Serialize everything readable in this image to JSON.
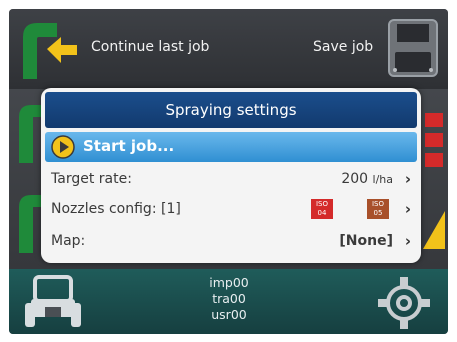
{
  "header": {
    "continue_label": "Continue last job",
    "save_label": "Save job"
  },
  "dialog": {
    "title": "Spraying settings",
    "start_label": "Start job...",
    "rows": {
      "target_rate": {
        "label": "Target rate:",
        "value": "200",
        "unit": "l/ha"
      },
      "nozzles": {
        "label": "Nozzles config: [1]",
        "badges": [
          {
            "line1": "ISO",
            "line2": "04",
            "color": "#d42a2a"
          },
          {
            "line1": "ISO",
            "line2": "05",
            "color": "#a8502a"
          }
        ]
      },
      "map": {
        "label": "Map:",
        "value": "[None]"
      }
    },
    "chevron": "›"
  },
  "footer": {
    "lines": [
      "imp00",
      "tra00",
      "usr00"
    ]
  },
  "colors": {
    "accent_green": "#1f8a3a",
    "arrow_yellow": "#f2c21a",
    "title_blue": "#1b4e8c",
    "start_blue": "#2f8fd2",
    "footer_teal": "#1f5c5a"
  },
  "icons": [
    "continue-arrow-icon",
    "save-disk-icon",
    "play-icon",
    "tractor-icon",
    "gear-icon",
    "chevron-right-icon"
  ]
}
